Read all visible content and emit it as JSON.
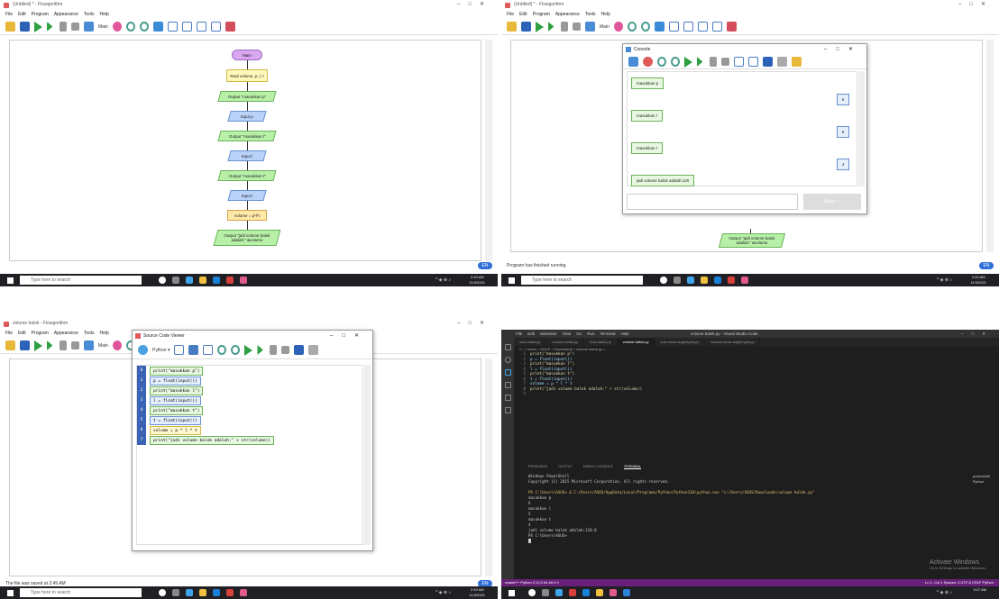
{
  "flowgorithm": {
    "title_untitled": "(Untitled) * - Flowgorithm",
    "title_saved": "volume balok - Flowgorithm",
    "menu": [
      "File",
      "Edit",
      "Program",
      "Appearance",
      "Tools",
      "Help"
    ],
    "main_select": "Main"
  },
  "flowchart": {
    "nodes": [
      {
        "kind": "main",
        "text": "Main"
      },
      {
        "kind": "decl",
        "text": "Real volume, p, l, t"
      },
      {
        "kind": "out",
        "text": "Output \"masukkan p\""
      },
      {
        "kind": "in",
        "text": "Input p"
      },
      {
        "kind": "out",
        "text": "Output \"masukkan l\""
      },
      {
        "kind": "in",
        "text": "Input l"
      },
      {
        "kind": "out",
        "text": "Output \"masukkan t\""
      },
      {
        "kind": "in",
        "text": "Input t"
      },
      {
        "kind": "assign",
        "text": "volume = p*l*t"
      },
      {
        "kind": "out",
        "text": "Output \"jadi volume balok adalah:\" &volume"
      }
    ]
  },
  "console": {
    "title": "Console",
    "messages": [
      {
        "type": "out",
        "text": "masukkan p"
      },
      {
        "type": "in",
        "text": "6"
      },
      {
        "type": "out",
        "text": "masukkan l"
      },
      {
        "type": "in",
        "text": "5"
      },
      {
        "type": "out",
        "text": "masukkan t"
      },
      {
        "type": "in",
        "text": "4"
      },
      {
        "type": "out",
        "text": "jadi volume balok adalah:120"
      }
    ],
    "enter_label": "Enter",
    "partial_output": "Output \"jadi volume balok adalah:\" &volume"
  },
  "status": {
    "q2": "Program has finished running.",
    "q3": "The file was saved at 2:49 AM"
  },
  "source_viewer": {
    "title": "Source Code Viewer",
    "language": "Python",
    "lines": [
      {
        "n": "0",
        "code": "print(\"masukkan p\")",
        "kind": "out"
      },
      {
        "n": "1",
        "code": "p = float(input())",
        "kind": "in"
      },
      {
        "n": "2",
        "code": "print(\"masukkan l\")",
        "kind": "out"
      },
      {
        "n": "3",
        "code": "l = float(input())",
        "kind": "in"
      },
      {
        "n": "4",
        "code": "print(\"masukkan t\")",
        "kind": "out"
      },
      {
        "n": "5",
        "code": "t = float(input())",
        "kind": "in"
      },
      {
        "n": "6",
        "code": "volume = p * l * t",
        "kind": "assign"
      },
      {
        "n": "7",
        "code": "print(\"jadi volume balok adalah:\" + str(volume))",
        "kind": "out"
      }
    ],
    "partial_output": "Output \"jadi volume balok adalah:\" &volume"
  },
  "taskbar": {
    "search": "Type here to search",
    "time": "2:49 AM",
    "date": "11/3/2021",
    "time_vs": "3:27 AM",
    "badge": "EN"
  },
  "vscode": {
    "window_title": "volume balok.py - Visual Studio Code",
    "menu": [
      "File",
      "Edit",
      "Selection",
      "View",
      "Go",
      "Run",
      "Terminal",
      "Help"
    ],
    "tabs": [
      "luas balok.py",
      "volume balok.py",
      "luas balok.py",
      "volume balok.py",
      "luas limas segiempat.py",
      "volume limas segiempat.py"
    ],
    "active_tab": 3,
    "breadcrumb": "C: > Users > ASUS > Downloads > volume balok.py > ...",
    "code": [
      "print(\"masukkan p\")",
      "p = float(input())",
      "print(\"masukkan l\")",
      "l = float(input())",
      "print(\"masukkan t\")",
      "t = float(input())",
      "volume = p * l * t",
      "print(\"jadi volume balok adalah:\" + str(volume))",
      ""
    ],
    "panel_tabs": [
      "PROBLEMS",
      "OUTPUT",
      "DEBUG CONSOLE",
      "TERMINAL"
    ],
    "terminal": [
      "Windows PowerShell",
      "Copyright (C) 2015 Microsoft Corporation. All rights reserved.",
      "",
      "PS C:\\Users\\ASUS> & C:/Users/ASUS/AppData/Local/Programs/Python/Python310/python.exe \"c:/Users/ASUS/Downloads/volume balok.py\"",
      "masukkan p",
      "6",
      "masukkan l",
      "5",
      "masukkan t",
      "4",
      "jadi volume balok adalah:120.0",
      "PS C:\\Users\\ASUS> "
    ],
    "side_terminals": [
      "powershell",
      "Python"
    ],
    "status_left": "master*+   Python 3.10.0 64-bit   0 0",
    "status_right": "Ln 1, Col 1   Spaces: 4   UTF-8   CRLF   Python",
    "activate_title": "Activate Windows",
    "activate_sub": "Go to Settings to activate Windows."
  },
  "colors": {
    "vs_status": "#68217a",
    "taskbar": "#1f1f24",
    "badge": "#2f6fd6"
  }
}
